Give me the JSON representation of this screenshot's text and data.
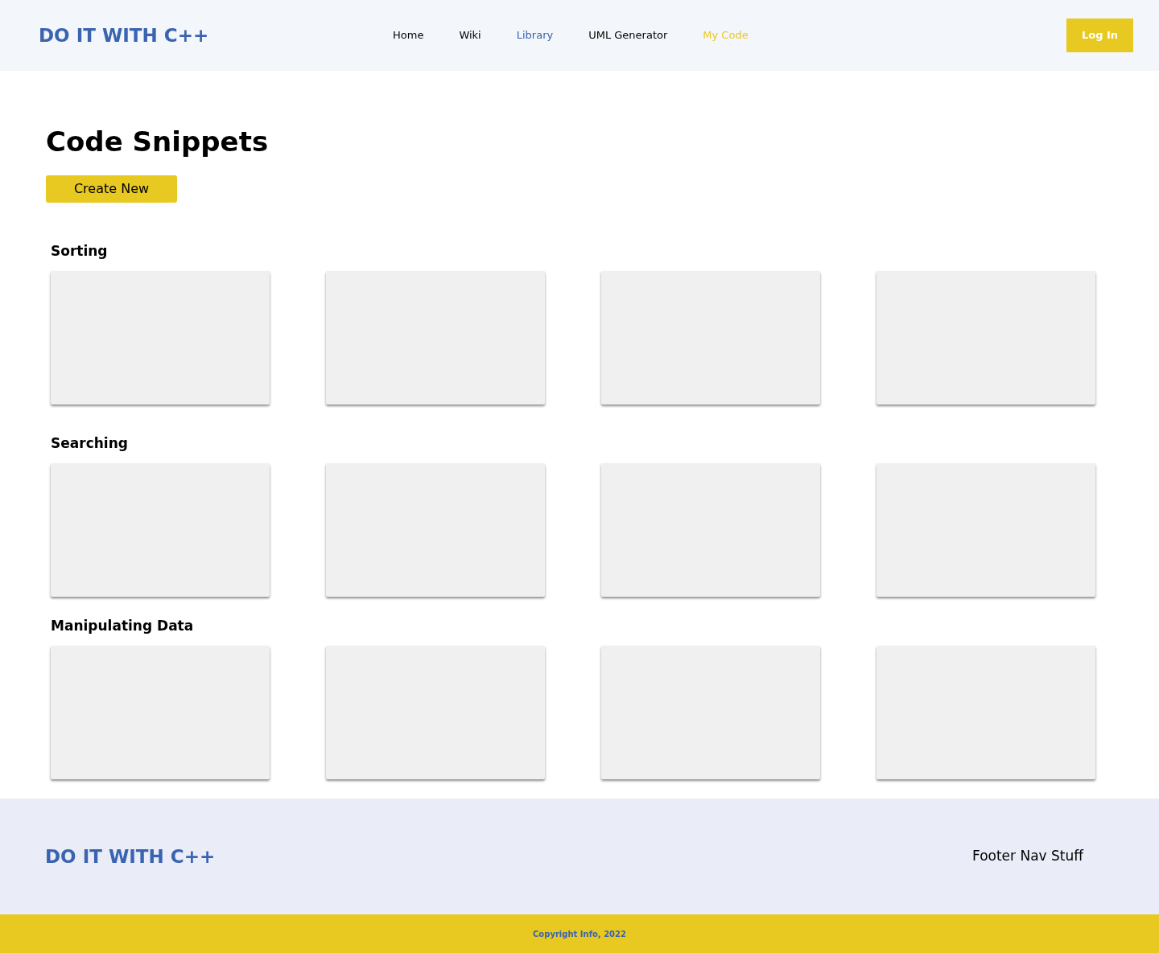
{
  "header": {
    "logo": "DO IT WITH C++",
    "nav": [
      {
        "label": "Home",
        "color": "#000000"
      },
      {
        "label": "Wiki",
        "color": "#000000"
      },
      {
        "label": "Library",
        "color": "#3a63b0"
      },
      {
        "label": "UML Generator",
        "color": "#000000"
      },
      {
        "label": "My Code",
        "color": "#e8c921"
      }
    ],
    "login": "Log In"
  },
  "page": {
    "title": "Code Snippets",
    "create_button": "Create New",
    "sections": [
      {
        "title": "Sorting"
      },
      {
        "title": "Searching"
      },
      {
        "title": "Manipulating Data"
      }
    ]
  },
  "footer": {
    "logo": "DO IT WITH C++",
    "nav": "Footer Nav Stuff",
    "copyright": "Copyright Info, 2022"
  }
}
